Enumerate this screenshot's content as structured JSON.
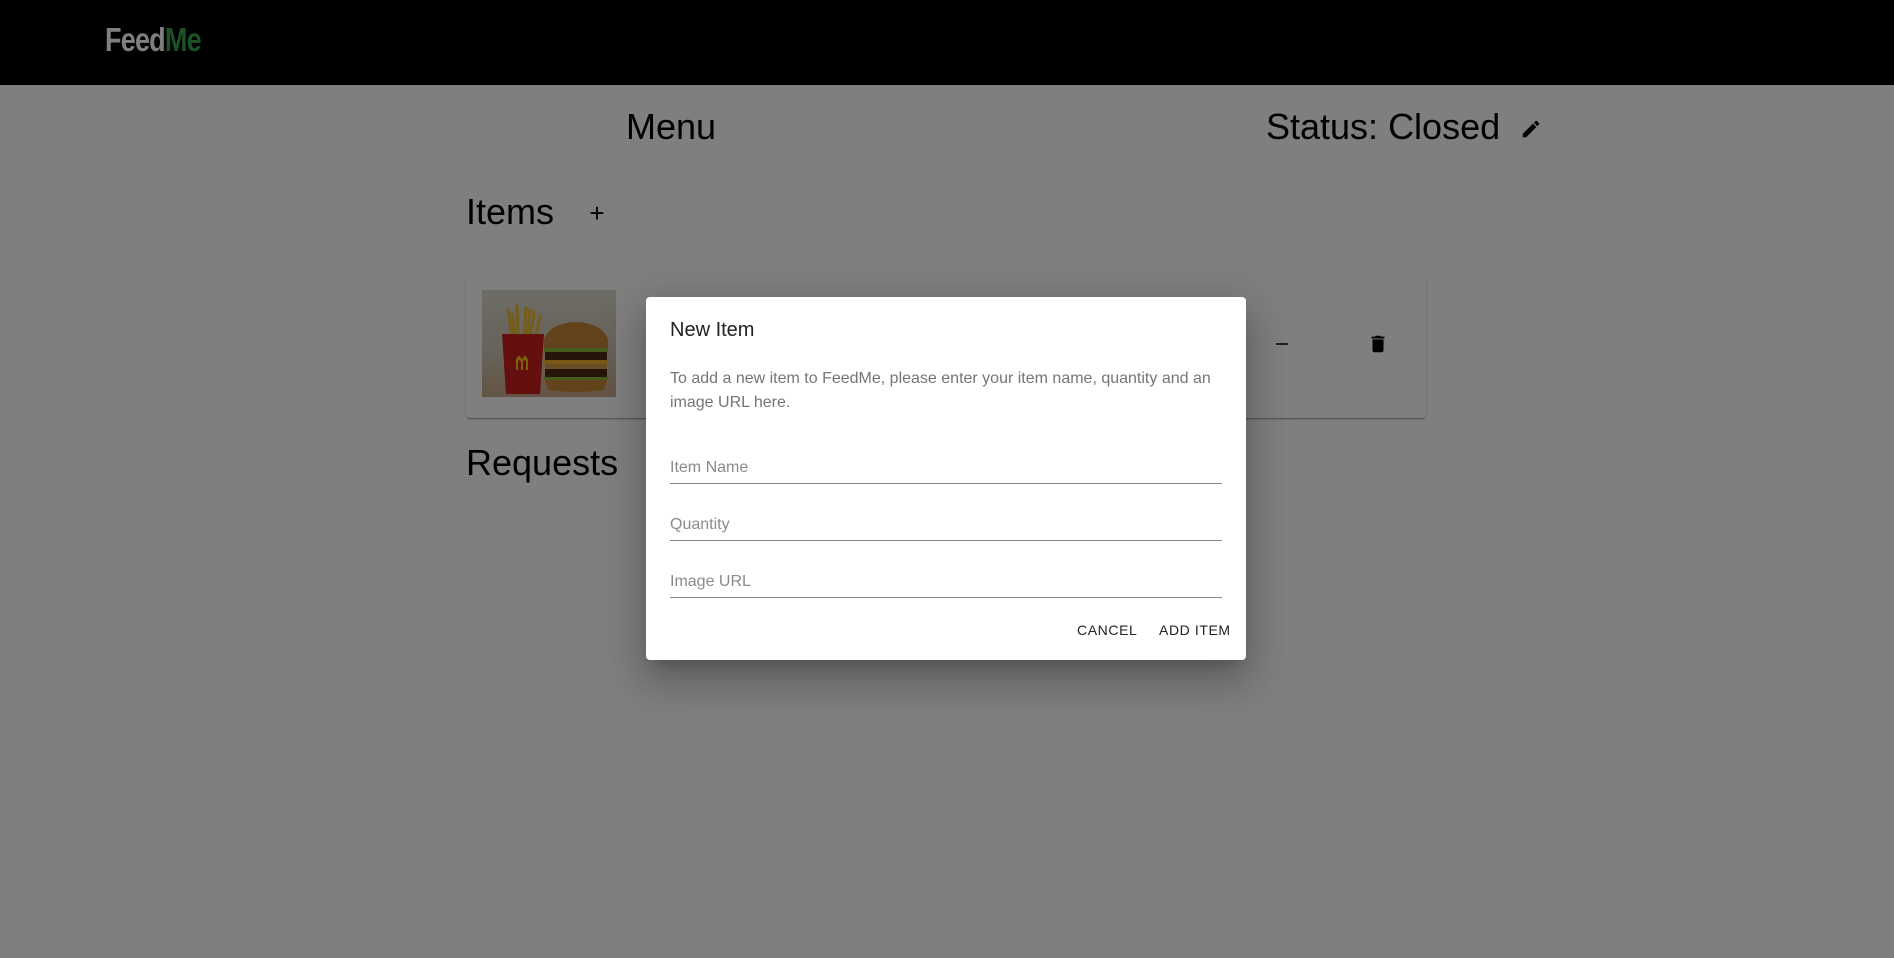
{
  "app": {
    "logo_part1": "Feed",
    "logo_part2": "Me",
    "logo_accent_color": "#3fa34d"
  },
  "page": {
    "menu_title": "Menu",
    "status_title": "Status: Closed",
    "items_heading": "Items",
    "add_item_symbol": "+",
    "requests_heading": "Requests"
  },
  "items": [
    {
      "image": "burger-and-fries-photo"
    }
  ],
  "dialog": {
    "title": "New Item",
    "description": "To add a new item to FeedMe, please enter your item name, quantity and an image URL here.",
    "fields": {
      "item_name_placeholder": "Item Name",
      "quantity_placeholder": "Quantity",
      "image_url_placeholder": "Image URL"
    },
    "cancel_label": "CANCEL",
    "add_label": "ADD ITEM"
  },
  "icons": {
    "edit": "pencil-icon",
    "decrement": "minus-icon",
    "delete": "trash-icon"
  }
}
